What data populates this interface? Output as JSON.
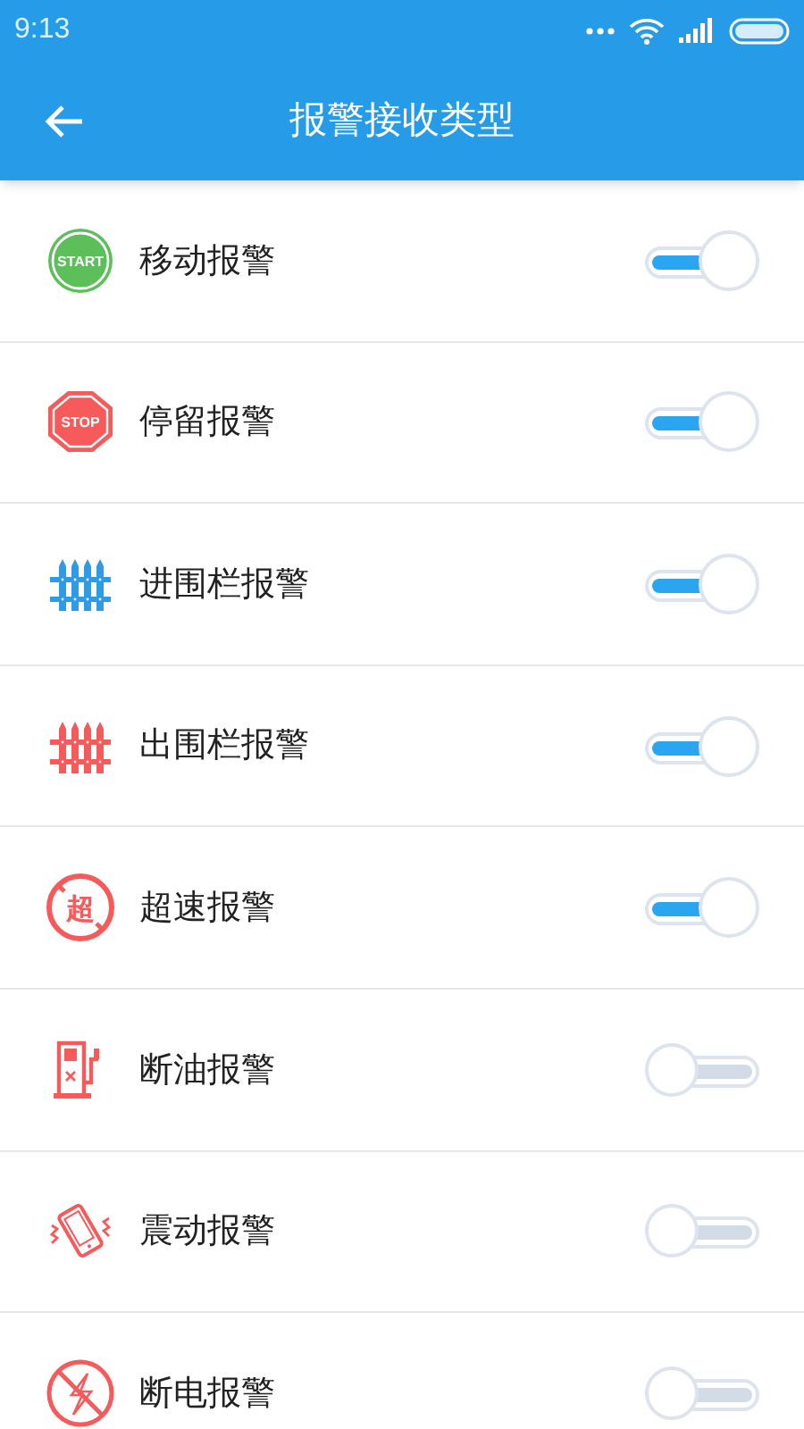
{
  "status_bar": {
    "time": "9:13"
  },
  "header": {
    "title": "报警接收类型"
  },
  "items": [
    {
      "kind": "start",
      "icon_text": "START",
      "label": "移动报警",
      "on": true
    },
    {
      "kind": "stop",
      "icon_text": "STOP",
      "label": "停留报警",
      "on": true
    },
    {
      "kind": "fence_in",
      "label": "进围栏报警",
      "on": true
    },
    {
      "kind": "fence_out",
      "label": "出围栏报警",
      "on": true
    },
    {
      "kind": "speed",
      "icon_text": "超",
      "label": "超速报警",
      "on": true
    },
    {
      "kind": "fuel",
      "label": "断油报警",
      "on": false
    },
    {
      "kind": "vibration",
      "label": "震动报警",
      "on": false
    },
    {
      "kind": "power",
      "label": "断电报警",
      "on": false
    }
  ]
}
